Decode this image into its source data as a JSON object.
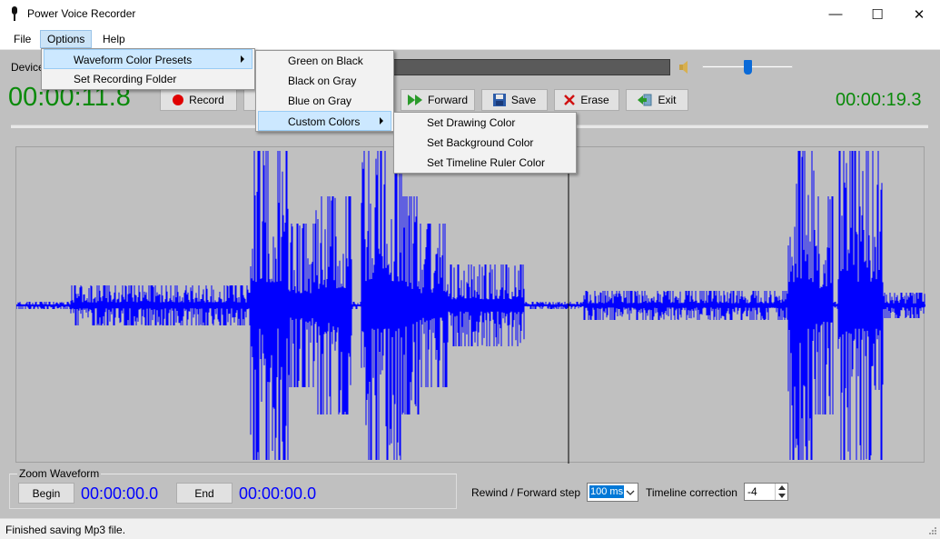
{
  "window": {
    "title": "Power Voice Recorder",
    "minimize_glyph": "—",
    "maximize_glyph": "☐",
    "close_glyph": "✕"
  },
  "menubar": {
    "file": "File",
    "options": "Options",
    "help": "Help"
  },
  "options_menu": {
    "items": [
      "Waveform Color Presets",
      "Set Recording Folder"
    ]
  },
  "presets_menu": {
    "items": [
      "Green on Black",
      "Black on Gray",
      "Blue on Gray",
      "Custom Colors"
    ]
  },
  "custom_menu": {
    "items": [
      "Set Drawing Color",
      "Set Background Color",
      "Set Timeline Ruler Color"
    ]
  },
  "device": {
    "label_partial": "Device"
  },
  "volume": {
    "level": 0.5
  },
  "toolbar": {
    "record": "Record",
    "forward": "Forward",
    "save": "Save",
    "erase": "Erase",
    "exit": "Exit"
  },
  "times": {
    "current": "00:00:11.8",
    "total": "00:00:19.3"
  },
  "zoom": {
    "group_title": "Zoom Waveform",
    "begin_label": "Begin",
    "begin_time": "00:00:00.0",
    "end_label": "End",
    "end_time": "00:00:00.0"
  },
  "step": {
    "label": "Rewind / Forward step",
    "value": "100 ms"
  },
  "timeline": {
    "label": "Timeline correction",
    "value": "-4"
  },
  "status": {
    "text": "Finished saving Mp3 file."
  },
  "colors": {
    "waveform": "#0000ff",
    "waveform_bg": "#c0c0c0",
    "time_green": "#0a8a0a",
    "time_blue": "#0000ff",
    "menu_highlight": "#cce8ff"
  }
}
